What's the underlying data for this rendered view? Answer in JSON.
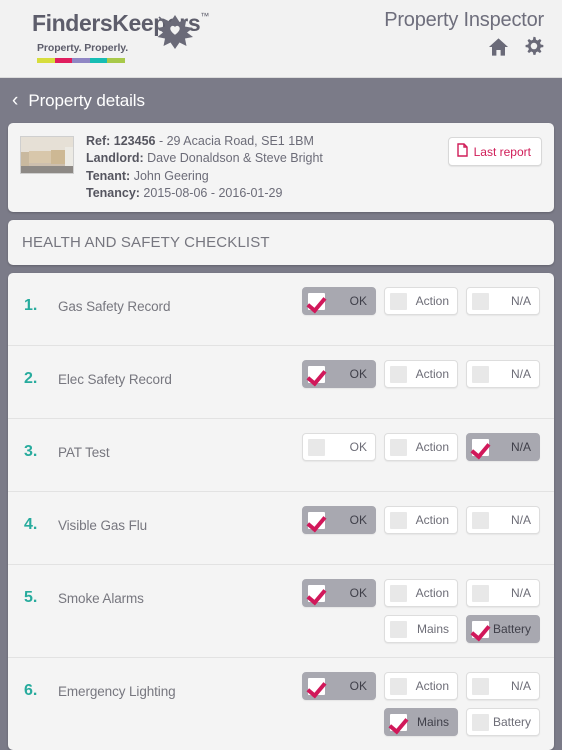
{
  "header": {
    "brand_name": "FindersKeepers",
    "brand_tm": "™",
    "brand_tagline": "Property. Properly.",
    "brand_colors": [
      "#d7dd3c",
      "#e01e5f",
      "#8f86c4",
      "#17bdb4",
      "#a8c94a"
    ],
    "app_title": "Property Inspector",
    "icons": [
      "home-icon",
      "gear-icon"
    ]
  },
  "breadcrumb": {
    "back_icon": "chevron-left-icon",
    "label": "Property details"
  },
  "property": {
    "ref_label": "Ref: 123456",
    "address": " - 29 Acacia Road, SE1 1BM",
    "landlord_label": "Landlord:",
    "landlord_value": " Dave Donaldson & Steve Bright",
    "tenant_label": "Tenant:",
    "tenant_value": " John Geering",
    "tenancy_label": "Tenancy:",
    "tenancy_value": " 2015-08-06 - 2016-01-29",
    "last_report_label": "Last report",
    "last_report_icon": "document-icon",
    "thumbnail_alt": "property-interior-photo"
  },
  "section": {
    "title": "HEALTH AND SAFETY CHECKLIST"
  },
  "accent_colors": {
    "number_teal": "#27ab9d",
    "check_crimson": "#d1185a",
    "selected_gray": "#a8a8b0",
    "page_bg": "#7b7b88"
  },
  "checklist": [
    {
      "number": "1.",
      "label": "Gas Safety Record",
      "options": [
        {
          "label": "OK",
          "selected": true
        },
        {
          "label": "Action",
          "selected": false
        },
        {
          "label": "N/A",
          "selected": false
        }
      ],
      "sub_options": []
    },
    {
      "number": "2.",
      "label": "Elec Safety Record",
      "options": [
        {
          "label": "OK",
          "selected": true
        },
        {
          "label": "Action",
          "selected": false
        },
        {
          "label": "N/A",
          "selected": false
        }
      ],
      "sub_options": []
    },
    {
      "number": "3.",
      "label": "PAT Test",
      "options": [
        {
          "label": "OK",
          "selected": false
        },
        {
          "label": "Action",
          "selected": false
        },
        {
          "label": "N/A",
          "selected": true
        }
      ],
      "sub_options": []
    },
    {
      "number": "4.",
      "label": "Visible Gas Flu",
      "options": [
        {
          "label": "OK",
          "selected": true
        },
        {
          "label": "Action",
          "selected": false
        },
        {
          "label": "N/A",
          "selected": false
        }
      ],
      "sub_options": []
    },
    {
      "number": "5.",
      "label": "Smoke Alarms",
      "options": [
        {
          "label": "OK",
          "selected": true
        },
        {
          "label": "Action",
          "selected": false
        },
        {
          "label": "N/A",
          "selected": false
        }
      ],
      "sub_options": [
        {
          "label": "Mains",
          "selected": false
        },
        {
          "label": "Battery",
          "selected": true
        }
      ]
    },
    {
      "number": "6.",
      "label": "Emergency Lighting",
      "options": [
        {
          "label": "OK",
          "selected": true
        },
        {
          "label": "Action",
          "selected": false
        },
        {
          "label": "N/A",
          "selected": false
        }
      ],
      "sub_options": [
        {
          "label": "Mains",
          "selected": true
        },
        {
          "label": "Battery",
          "selected": false
        }
      ]
    }
  ]
}
